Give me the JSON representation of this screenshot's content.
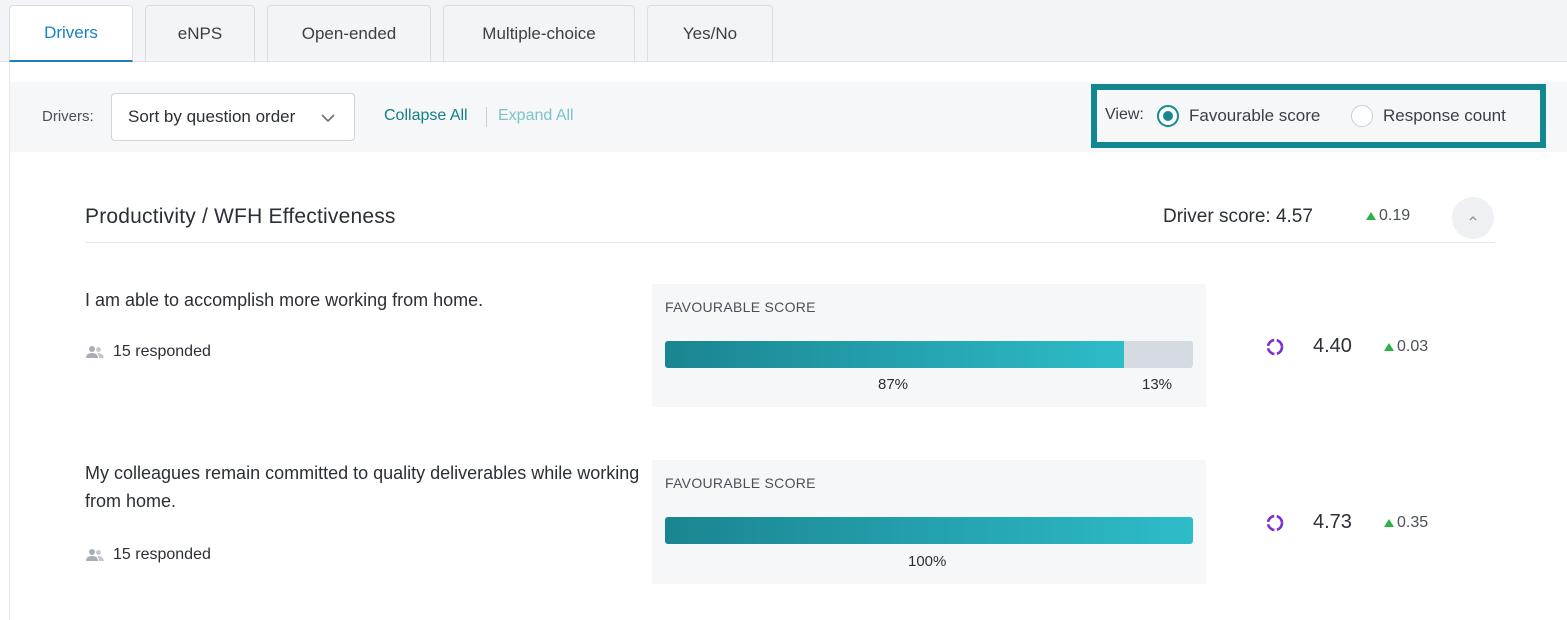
{
  "tabs": [
    {
      "label": "Drivers",
      "active": true
    },
    {
      "label": "eNPS",
      "active": false
    },
    {
      "label": "Open-ended",
      "active": false
    },
    {
      "label": "Multiple-choice",
      "active": false
    },
    {
      "label": "Yes/No",
      "active": false
    }
  ],
  "toolbar": {
    "drivers_label": "Drivers:",
    "sort_value": "Sort by question order",
    "collapse_all": "Collapse All",
    "expand_all": "Expand All"
  },
  "view": {
    "label": "View:",
    "options": [
      {
        "label": "Favourable score",
        "selected": true
      },
      {
        "label": "Response count",
        "selected": false
      }
    ]
  },
  "section": {
    "title": "Productivity / WFH Effectiveness",
    "driver_score": "Driver score: 4.57",
    "driver_delta": "0.19"
  },
  "questions": [
    {
      "text": "I am able to accomplish more working from home.",
      "responded": "15 responded",
      "card_label": "FAVOURABLE SCORE",
      "favourable_pct": "87%",
      "unfavourable_pct": "13%",
      "favourable_fraction": 0.87,
      "score": "4.40",
      "delta": "0.03"
    },
    {
      "text": "My colleagues remain committed to quality deliverables while working from home.",
      "responded": "15 responded",
      "card_label": "FAVOURABLE SCORE",
      "favourable_pct": "100%",
      "favourable_fraction": 1.0,
      "score": "4.73",
      "delta": "0.35"
    }
  ],
  "colors": {
    "accent": "#1b7fc4",
    "teal": "#12878f",
    "positive": "#2bb34a",
    "spinner": "#7b2fd0"
  }
}
